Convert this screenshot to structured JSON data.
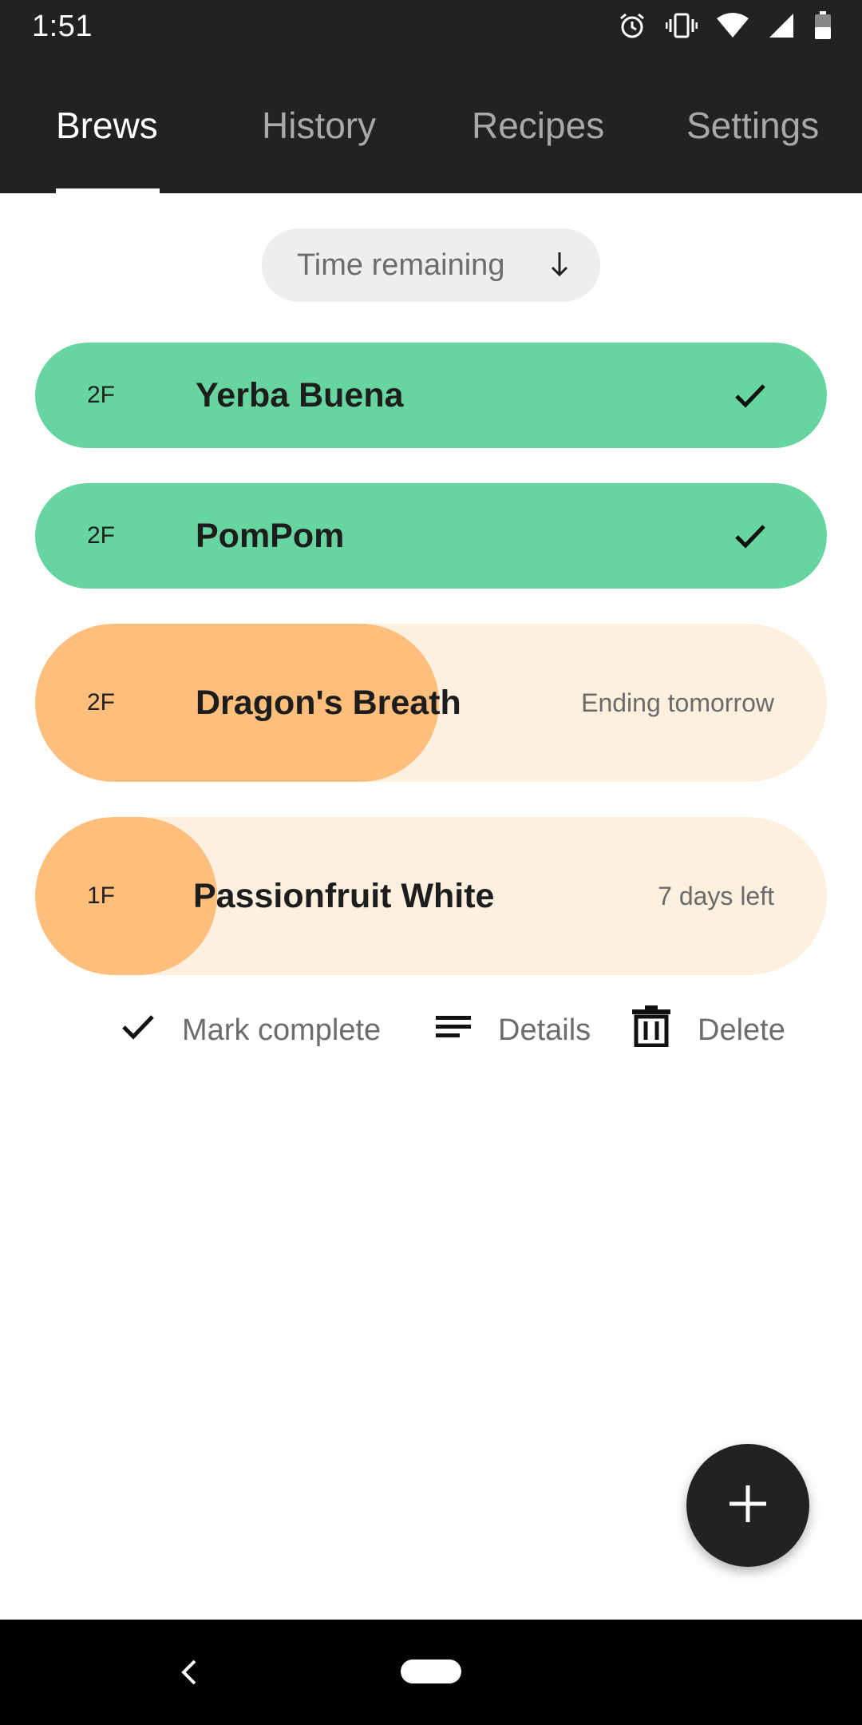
{
  "status_bar": {
    "time": "1:51",
    "icons": [
      "alarm-icon",
      "vibrate-icon",
      "wifi-icon",
      "signal-icon",
      "battery-icon"
    ]
  },
  "tabs": [
    {
      "label": "Brews",
      "active": true
    },
    {
      "label": "History",
      "active": false
    },
    {
      "label": "Recipes",
      "active": false
    },
    {
      "label": "Settings",
      "active": false
    }
  ],
  "sort": {
    "label": "Time remaining",
    "icon": "arrow-down-icon"
  },
  "brews": [
    {
      "shelf": "2F",
      "name": "Yerba Buena",
      "state": "complete",
      "icon": "check-icon"
    },
    {
      "shelf": "2F",
      "name": "PomPom",
      "state": "complete",
      "icon": "check-icon"
    },
    {
      "shelf": "2F",
      "name": "Dragon's Breath",
      "state": "in-progress",
      "status": "Ending tomorrow",
      "progress": 0.51
    },
    {
      "shelf": "1F",
      "name": "Passionfruit White",
      "state": "in-progress",
      "status": "7 days left",
      "progress": 0.23
    }
  ],
  "actions": {
    "mark_complete": "Mark complete",
    "details": "Details",
    "delete": "Delete"
  },
  "fab": {
    "icon": "plus-icon"
  },
  "nav": {
    "back_icon": "back-icon",
    "home_icon": "home-pill-icon"
  },
  "colors": {
    "header": "#222222",
    "complete": "#66d59f",
    "progress_fill": "#fdbf7b",
    "progress_track": "#fdf0df"
  }
}
